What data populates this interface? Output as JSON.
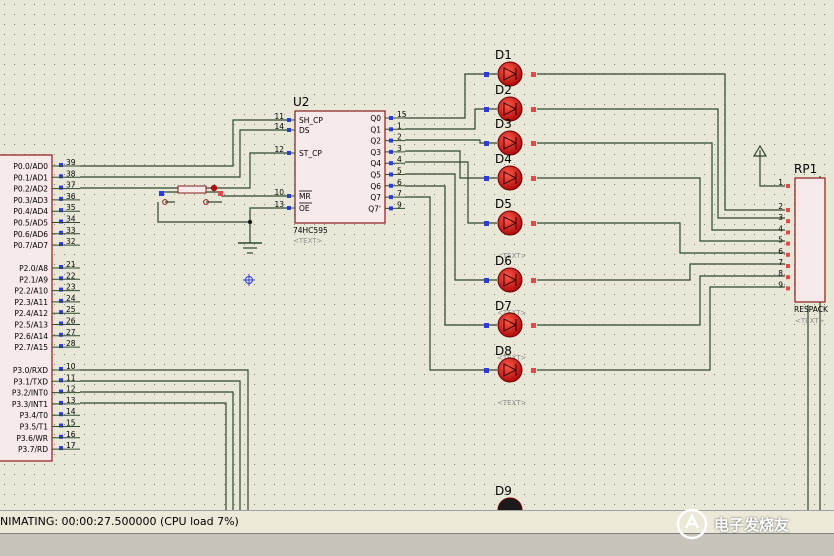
{
  "status_bar": {
    "text": "NIMATING: 00:00:27.500000 (CPU load 7%)"
  },
  "watermark": {
    "text": "电子发烧友",
    "logo_icon": "elecfans-logo-icon"
  },
  "colors": {
    "canvas": "#e9e8d8",
    "wire": "#2b4a2b",
    "component_outline": "#8b1a1a",
    "led": "#cc1111",
    "pin_marker_blue": "#2c3cd8",
    "pin_marker_red": "#e04a4a"
  },
  "mcu": {
    "p0_pins": [
      {
        "label": "P0.0/AD0",
        "num": "39"
      },
      {
        "label": "P0.1/AD1",
        "num": "38"
      },
      {
        "label": "P0.2/AD2",
        "num": "37"
      },
      {
        "label": "P0.3/AD3",
        "num": "36"
      },
      {
        "label": "P0.4/AD4",
        "num": "35"
      },
      {
        "label": "P0.5/AD5",
        "num": "34"
      },
      {
        "label": "P0.6/AD6",
        "num": "33"
      },
      {
        "label": "P0.7/AD7",
        "num": "32"
      }
    ],
    "p2_pins": [
      {
        "label": "P2.0/A8",
        "num": "21"
      },
      {
        "label": "P2.1/A9",
        "num": "22"
      },
      {
        "label": "P2.2/A10",
        "num": "23"
      },
      {
        "label": "P2.3/A11",
        "num": "24"
      },
      {
        "label": "P2.4/A12",
        "num": "25"
      },
      {
        "label": "P2.5/A13",
        "num": "26"
      },
      {
        "label": "P2.6/A14",
        "num": "27"
      },
      {
        "label": "P2.7/A15",
        "num": "28"
      }
    ],
    "p3_pins": [
      {
        "label": "P3.0/RXD",
        "num": "10"
      },
      {
        "label": "P3.1/TXD",
        "num": "11"
      },
      {
        "label": "P3.2/INT0",
        "num": "12"
      },
      {
        "label": "P3.3/INT1",
        "num": "13"
      },
      {
        "label": "P3.4/T0",
        "num": "14"
      },
      {
        "label": "P3.5/T1",
        "num": "15"
      },
      {
        "label": "P3.6/WR",
        "num": "16"
      },
      {
        "label": "P3.7/RD",
        "num": "17"
      }
    ]
  },
  "u2": {
    "ref": "U2",
    "part": "74HC595",
    "text_placeholder": "<TEXT>",
    "left_pins": [
      {
        "label": "SH_CP",
        "num": "11"
      },
      {
        "label": "DS",
        "num": "14"
      },
      {
        "label": "ST_CP",
        "num": "12"
      },
      {
        "label": "MR",
        "num": "10"
      },
      {
        "label": "OE",
        "num": "13"
      }
    ],
    "right_pins": [
      {
        "label": "Q0",
        "num": "15"
      },
      {
        "label": "Q1",
        "num": "1"
      },
      {
        "label": "Q2",
        "num": "2"
      },
      {
        "label": "Q3",
        "num": "3"
      },
      {
        "label": "Q4",
        "num": "4"
      },
      {
        "label": "Q5",
        "num": "5"
      },
      {
        "label": "Q6",
        "num": "6"
      },
      {
        "label": "Q7",
        "num": "7"
      },
      {
        "label": "Q7'",
        "num": "9"
      }
    ]
  },
  "leds": [
    {
      "ref": "D1",
      "text": ""
    },
    {
      "ref": "D2",
      "text": ""
    },
    {
      "ref": "D3",
      "text": ""
    },
    {
      "ref": "D4",
      "text": ""
    },
    {
      "ref": "D5",
      "text": "<TEXT>"
    },
    {
      "ref": "D6",
      "text": "<TEXT>"
    },
    {
      "ref": "D7",
      "text": "<TEXT>"
    },
    {
      "ref": "D8",
      "text": "<TEXT>"
    },
    {
      "ref": "D9",
      "text": ""
    }
  ],
  "rp1": {
    "ref": "RP1",
    "part": "RESPACK",
    "text_placeholder": "<TEXT>",
    "pins": [
      "1",
      "2",
      "3",
      "4",
      "5",
      "6",
      "7",
      "8",
      "9"
    ]
  }
}
